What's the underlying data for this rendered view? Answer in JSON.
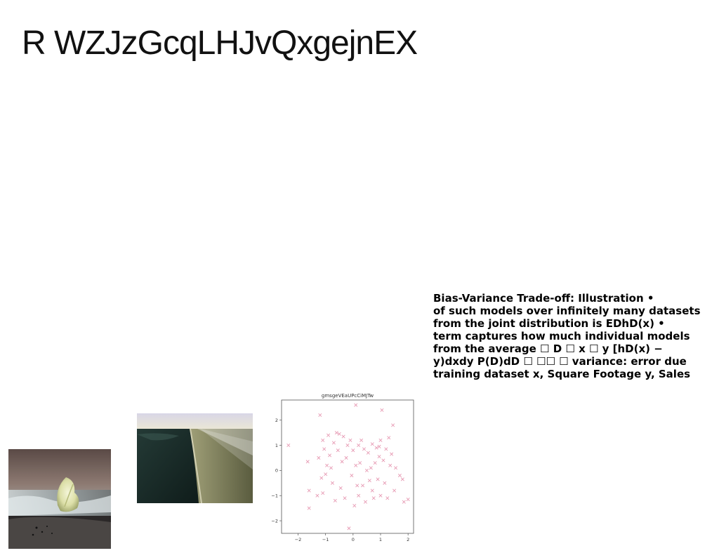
{
  "page": {
    "title": "R WZJzGcqLHJvQxgejnEX",
    "text_lines": [
      "Bias-Variance Trade-off: Illustration •",
      "of such models over infinitely many datasets",
      "from the joint distribution is EDhD(x) •",
      "term captures how much individual models",
      "from the average ☐ D ☐ x ☐ y [hD(x) −",
      "y)dxdy P(D)dD ☐ ☐☐ ☐ variance: error due",
      "training dataset x, Square Footage y, Sales"
    ]
  },
  "colors": {
    "marker": "#e79bb4",
    "axis": "#555555"
  },
  "chart_data": {
    "type": "scatter",
    "title": "gmsgeVEaUPcCiMJTw",
    "xlabel": "",
    "ylabel": "",
    "xlim": [
      -2.6,
      2.2
    ],
    "ylim": [
      -2.5,
      2.8
    ],
    "xticks": [
      -2,
      -1,
      0,
      1,
      2
    ],
    "yticks": [
      -2,
      -1,
      0,
      1,
      2
    ],
    "xtick_labels": [
      "−2",
      "−1",
      "0",
      "1",
      "2"
    ],
    "ytick_labels": [
      "−2",
      "−1",
      "0",
      "1",
      "2"
    ],
    "marker": "x",
    "grid": false,
    "points": [
      [
        -2.35,
        1.0
      ],
      [
        -1.65,
        0.35
      ],
      [
        -1.6,
        -0.8
      ],
      [
        -1.6,
        -1.5
      ],
      [
        -1.3,
        -1.0
      ],
      [
        -1.25,
        0.5
      ],
      [
        -1.2,
        2.2
      ],
      [
        -1.15,
        -0.3
      ],
      [
        -1.1,
        -0.9
      ],
      [
        -1.1,
        1.2
      ],
      [
        -1.05,
        0.85
      ],
      [
        -1.0,
        -0.15
      ],
      [
        -0.95,
        0.2
      ],
      [
        -0.9,
        1.4
      ],
      [
        -0.85,
        0.6
      ],
      [
        -0.8,
        0.1
      ],
      [
        -0.75,
        -0.5
      ],
      [
        -0.7,
        1.1
      ],
      [
        -0.65,
        -1.2
      ],
      [
        -0.6,
        1.5
      ],
      [
        -0.55,
        0.8
      ],
      [
        -0.5,
        1.45
      ],
      [
        -0.45,
        -0.7
      ],
      [
        -0.4,
        0.35
      ],
      [
        -0.35,
        1.35
      ],
      [
        -0.3,
        -1.1
      ],
      [
        -0.25,
        0.5
      ],
      [
        -0.2,
        1.0
      ],
      [
        -0.15,
        -2.3
      ],
      [
        -0.1,
        1.2
      ],
      [
        -0.05,
        -0.2
      ],
      [
        0.0,
        0.8
      ],
      [
        0.05,
        -1.4
      ],
      [
        0.1,
        0.2
      ],
      [
        0.1,
        2.6
      ],
      [
        0.15,
        -0.6
      ],
      [
        0.2,
        1.0
      ],
      [
        0.2,
        -1.0
      ],
      [
        0.25,
        0.3
      ],
      [
        0.3,
        1.2
      ],
      [
        0.35,
        -0.6
      ],
      [
        0.4,
        0.85
      ],
      [
        0.45,
        -1.25
      ],
      [
        0.5,
        0.0
      ],
      [
        0.55,
        0.7
      ],
      [
        0.6,
        -0.4
      ],
      [
        0.65,
        0.1
      ],
      [
        0.7,
        -0.8
      ],
      [
        0.7,
        1.05
      ],
      [
        0.75,
        -1.1
      ],
      [
        0.8,
        0.3
      ],
      [
        0.85,
        0.9
      ],
      [
        0.9,
        -0.35
      ],
      [
        0.95,
        0.95
      ],
      [
        0.95,
        0.55
      ],
      [
        1.0,
        1.2
      ],
      [
        1.0,
        -1.0
      ],
      [
        1.05,
        2.4
      ],
      [
        1.1,
        0.4
      ],
      [
        1.15,
        -0.5
      ],
      [
        1.2,
        0.85
      ],
      [
        1.25,
        -1.1
      ],
      [
        1.3,
        1.3
      ],
      [
        1.35,
        0.2
      ],
      [
        1.4,
        0.65
      ],
      [
        1.45,
        1.8
      ],
      [
        1.5,
        -0.8
      ],
      [
        1.55,
        0.1
      ],
      [
        1.7,
        -0.2
      ],
      [
        1.8,
        -0.35
      ],
      [
        1.85,
        -1.25
      ],
      [
        2.0,
        -1.15
      ]
    ]
  }
}
